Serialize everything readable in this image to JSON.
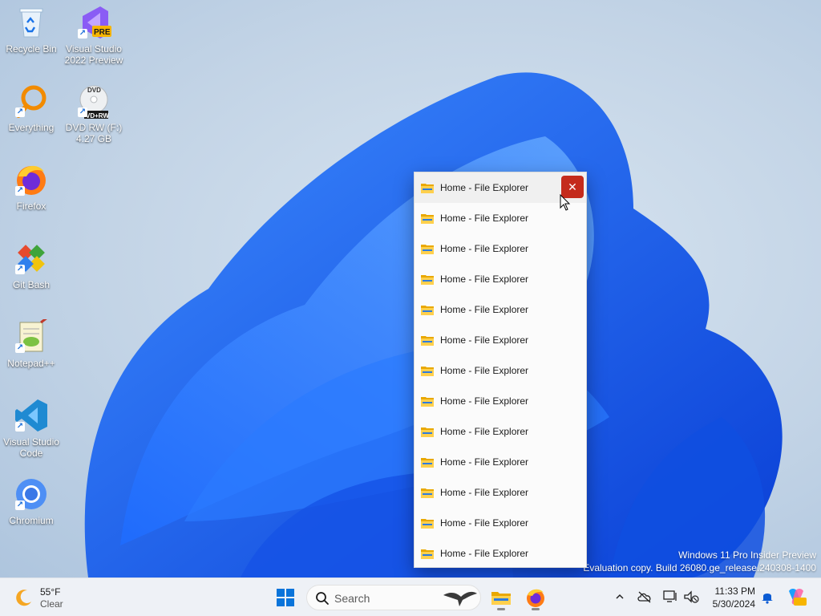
{
  "desktop_icons": [
    {
      "label": "Recycle Bin",
      "icon": "recycle-bin-icon"
    },
    {
      "label": "Visual Studio 2022 Preview",
      "icon": "visual-studio-preview-icon",
      "badge": "PRE"
    },
    {
      "label": "Everything",
      "icon": "everything-search-icon"
    },
    {
      "label": "DVD RW (F:) 4.27 GB",
      "icon": "dvd-drive-icon",
      "disc_top": "DVD",
      "disc_bottom": "VD+RW"
    },
    {
      "label": "Firefox",
      "icon": "firefox-icon"
    },
    {
      "label": "Git Bash",
      "icon": "git-bash-icon"
    },
    {
      "label": "Notepad++",
      "icon": "notepad-plus-plus-icon"
    },
    {
      "label": "Visual Studio Code",
      "icon": "vscode-icon"
    },
    {
      "label": "Chromium",
      "icon": "chromium-icon"
    }
  ],
  "thumbnail_list": {
    "items": [
      "Home - File Explorer",
      "Home - File Explorer",
      "Home - File Explorer",
      "Home - File Explorer",
      "Home - File Explorer",
      "Home - File Explorer",
      "Home - File Explorer",
      "Home - File Explorer",
      "Home - File Explorer",
      "Home - File Explorer",
      "Home - File Explorer",
      "Home - File Explorer",
      "Home - File Explorer"
    ],
    "close_glyph": "✕",
    "hover_index": 0
  },
  "watermark": {
    "line1": "Windows 11 Pro Insider Preview",
    "line2": "Evaluation copy. Build 26080.ge_release.240308-1400"
  },
  "taskbar": {
    "weather": {
      "temp": "55°F",
      "condition": "Clear",
      "icon": "moon-icon"
    },
    "search_placeholder": "Search",
    "clock": {
      "time": "11:33 PM",
      "date": "5/30/2024"
    }
  },
  "colors": {
    "accent": "#0067c0",
    "close_red": "#c42b1c",
    "folder_yellow": "#f8c845"
  }
}
